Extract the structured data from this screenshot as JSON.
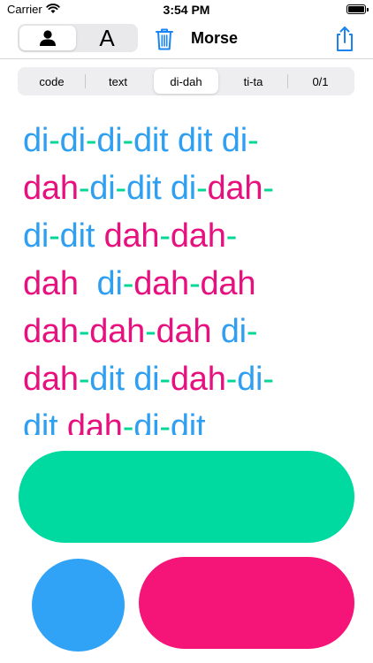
{
  "status": {
    "carrier": "Carrier",
    "time": "3:54 PM"
  },
  "nav": {
    "mode_letter": "A",
    "title": "Morse"
  },
  "tabs": [
    "code",
    "text",
    "di-dah",
    "ti-ta",
    "0/1"
  ],
  "selected_tab": "di-dah",
  "morse_text": [
    "di-di-di-dit dit di-",
    "dah-di-dit di-dah-",
    "di-dit dah-dah-",
    "dah  di-dah-dah",
    "dah-dah-dah di-",
    "dah-dit di-dah-di-",
    "dit dah-di-dit"
  ],
  "colors": {
    "di": "#2f9ff2",
    "dah": "#e6117e",
    "separator": "#00d696",
    "space_key": "#00d99f",
    "dot_key": "#30a3f7",
    "dash_key": "#f51478"
  }
}
